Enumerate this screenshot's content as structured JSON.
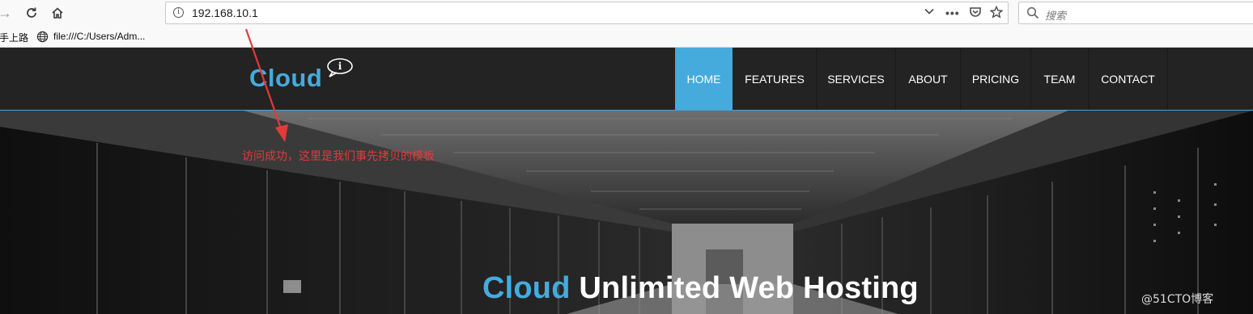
{
  "browser": {
    "url": "192.168.10.1",
    "search_placeholder": "搜索",
    "bookmarks": [
      "手上路",
      "file:///C:/Users/Adm..."
    ]
  },
  "site": {
    "logo_text": "Cloud",
    "nav_items": [
      "HOME",
      "FEATURES",
      "SERVICES",
      "ABOUT",
      "PRICING",
      "TEAM",
      "CONTACT"
    ],
    "active_nav": "HOME",
    "hero": {
      "title_accent": "Cloud",
      "title_rest": "Unlimited Web Hosting"
    }
  },
  "annotation": {
    "text": "访问成功，这里是我们事先拷贝的模板"
  },
  "watermark": "@51CTO博客",
  "colors": {
    "accent": "#45abdd",
    "header_bg": "#232323",
    "annotation_red": "#e33a3a"
  }
}
